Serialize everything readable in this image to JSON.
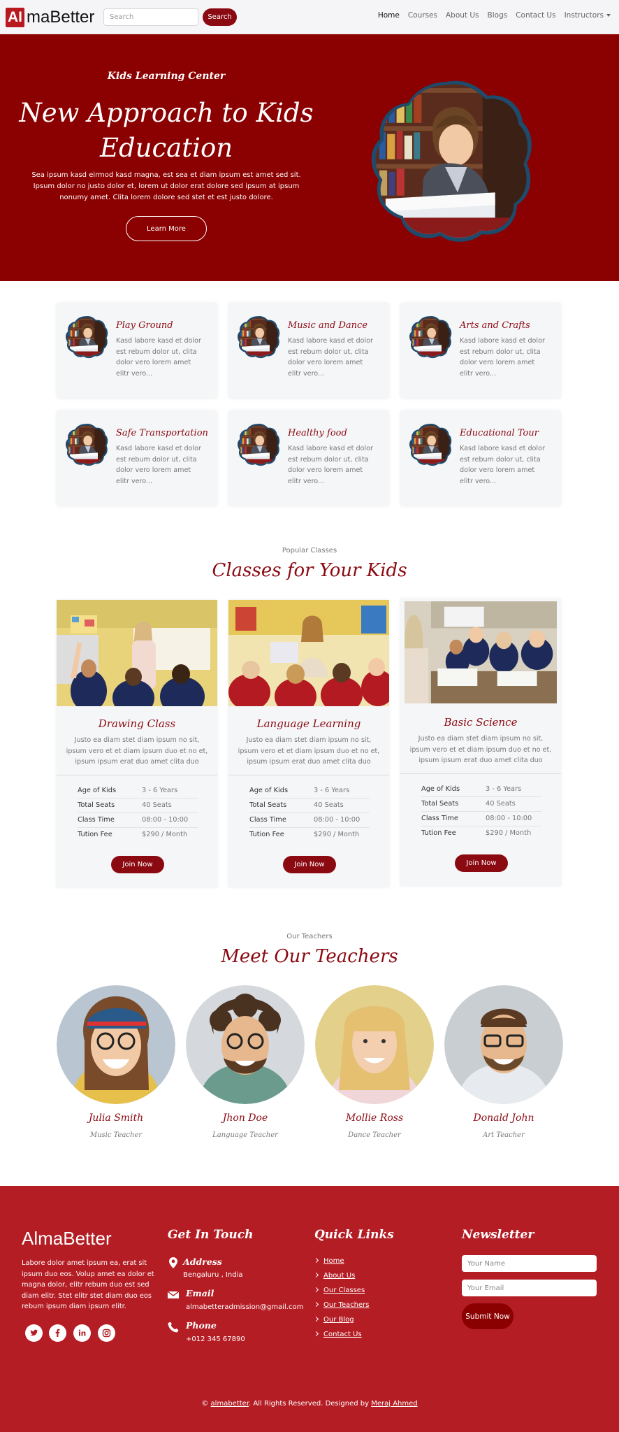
{
  "navbar": {
    "brand_box": "AI",
    "brand_rest": "maBetter",
    "search_placeholder": "Search",
    "search_button": "Search",
    "links": [
      "Home",
      "Courses",
      "About Us",
      "Blogs",
      "Contact Us",
      "Instructors"
    ],
    "active": "Home"
  },
  "hero": {
    "kicker": "Kids Learning Center",
    "title": "New Approach to Kids Education",
    "text": "Sea ipsum kasd eirmod kasd magna, est sea et diam ipsum est amet sed sit. Ipsum dolor no justo dolor et, lorem ut dolor erat dolore sed ipsum at ipsum nonumy amet. Clita lorem dolore sed stet et est justo dolore.",
    "button": "Learn More"
  },
  "facilities": [
    {
      "title": "Play Ground",
      "text": "Kasd labore kasd et dolor est rebum dolor ut, clita dolor vero lorem amet elitr vero..."
    },
    {
      "title": "Music and Dance",
      "text": "Kasd labore kasd et dolor est rebum dolor ut, clita dolor vero lorem amet elitr vero..."
    },
    {
      "title": "Arts and Crafts",
      "text": "Kasd labore kasd et dolor est rebum dolor ut, clita dolor vero lorem amet elitr vero..."
    },
    {
      "title": "Safe Transportation",
      "text": "Kasd labore kasd et dolor est rebum dolor ut, clita dolor vero lorem amet elitr vero..."
    },
    {
      "title": "Healthy food",
      "text": "Kasd labore kasd et dolor est rebum dolor ut, clita dolor vero lorem amet elitr vero..."
    },
    {
      "title": "Educational Tour",
      "text": "Kasd labore kasd et dolor est rebum dolor ut, clita dolor vero lorem amet elitr vero..."
    }
  ],
  "classes_section": {
    "kicker": "Popular Classes",
    "title": "Classes for Your Kids",
    "row_labels": [
      "Age of Kids",
      "Total Seats",
      "Class Time",
      "Tution Fee"
    ],
    "button": "Join Now",
    "classes": [
      {
        "title": "Drawing Class",
        "desc": "Justo ea diam stet diam ipsum no sit, ipsum vero et et diam ipsum duo et no et, ipsum ipsum erat duo amet clita duo",
        "age": "3 - 6 Years",
        "seats": "40 Seats",
        "time": "08:00 - 10:00",
        "fee": "$290 / Month"
      },
      {
        "title": "Language Learning",
        "desc": "Justo ea diam stet diam ipsum no sit, ipsum vero et et diam ipsum duo et no et, ipsum ipsum erat duo amet clita duo",
        "age": "3 - 6 Years",
        "seats": "40 Seats",
        "time": "08:00 - 10:00",
        "fee": "$290 / Month"
      },
      {
        "title": "Basic Science",
        "desc": "Justo ea diam stet diam ipsum no sit, ipsum vero et et diam ipsum duo et no et, ipsum ipsum erat duo amet clita duo",
        "age": "3 - 6 Years",
        "seats": "40 Seats",
        "time": "08:00 - 10:00",
        "fee": "$290 / Month"
      }
    ]
  },
  "teachers_section": {
    "kicker": "Our Teachers",
    "title": "Meet Our Teachers",
    "teachers": [
      {
        "name": "Julia Smith",
        "role": "Music Teacher"
      },
      {
        "name": "Jhon Doe",
        "role": "Language Teacher"
      },
      {
        "name": "Mollie Ross",
        "role": "Dance Teacher"
      },
      {
        "name": "Donald John",
        "role": "Art Teacher"
      }
    ]
  },
  "footer": {
    "brand": "AlmaBetter",
    "about": "Labore dolor amet ipsum ea, erat sit ipsum duo eos. Volup amet ea dolor et magna dolor, elitr rebum duo est sed diam elitr. Stet elitr stet diam duo eos rebum ipsum diam ipsum elitr.",
    "social": [
      "twitter-icon",
      "facebook-icon",
      "linkedin-icon",
      "instagram-icon"
    ],
    "contact_heading": "Get In Touch",
    "address_label": "Address",
    "address": "Bengaluru , India",
    "email_label": "Email",
    "email": "almabetteradmission@gmail.com",
    "phone_label": "Phone",
    "phone": "+012 345 67890",
    "links_heading": "Quick Links",
    "links": [
      "Home",
      "About Us",
      "Our Classes",
      "Our Teachers",
      "Our Blog",
      "Contact Us"
    ],
    "newsletter_heading": "Newsletter",
    "name_placeholder": "Your Name",
    "email_placeholder": "Your Email",
    "submit": "Submit Now",
    "copyright_prefix": "©",
    "copyright_link": "almabetter",
    "copyright_mid": ". All Rights Reserved. Designed by",
    "designer": "Meraj Ahmed"
  },
  "colors": {
    "primary": "#8b0000",
    "accent": "#8b0a12",
    "footer": "#b41d24",
    "card": "#f5f6f8"
  }
}
